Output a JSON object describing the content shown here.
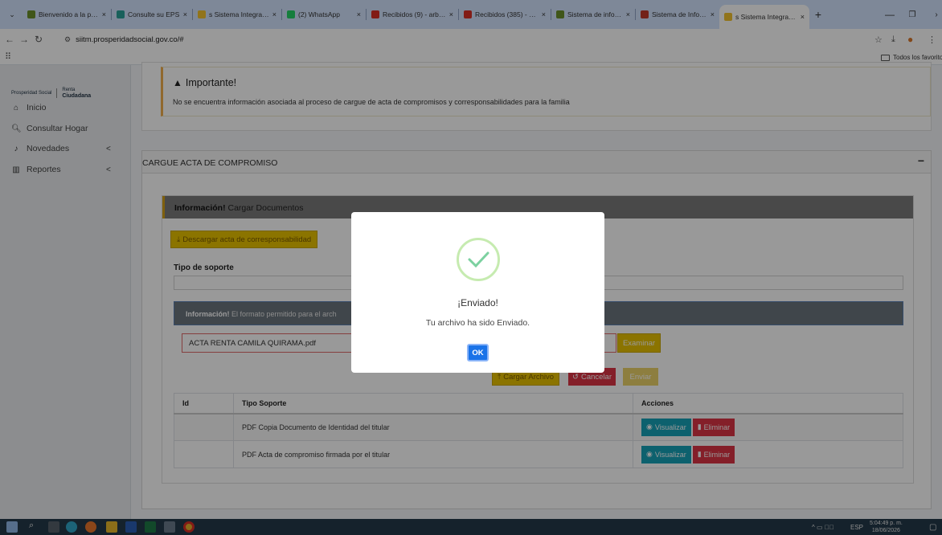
{
  "browser": {
    "tabs": [
      {
        "title": "Bienvenido a la págir",
        "color": "#6b8f2a"
      },
      {
        "title": "Consulte su EPS",
        "color": "#2aa198"
      },
      {
        "title": "s Sistema Integrado d",
        "color": "#f2c12e"
      },
      {
        "title": "(2) WhatsApp",
        "color": "#25d366"
      },
      {
        "title": "Recibidos (9) - arbela",
        "color": "#d93025"
      },
      {
        "title": "Recibidos (385) - prod",
        "color": "#d93025"
      },
      {
        "title": "Sistema de informaci",
        "color": "#6b8f2a"
      },
      {
        "title": "Sistema de Informaci",
        "color": "#c0392b"
      },
      {
        "title": "s Sistema Integrado d",
        "color": "#f2c12e",
        "active": true
      }
    ],
    "new_tab": "+",
    "url": "siitm.prosperidadsocial.gov.co/#",
    "bookmarks_all": "Todos los favoritos"
  },
  "sidebar": {
    "logo_left": "Prosperidad Social",
    "logo_right_top": "Renta",
    "logo_right_bottom": "Ciudadana",
    "items": [
      {
        "label": "Inicio",
        "icon": "home-icon"
      },
      {
        "label": "Consultar Hogar",
        "icon": "search-icon"
      },
      {
        "label": "Novedades",
        "icon": "bell-icon",
        "chevron": "<"
      },
      {
        "label": "Reportes",
        "icon": "chart-icon",
        "chevron": "<"
      }
    ]
  },
  "alert": {
    "title": "Importante!",
    "body": "No se encuentra información asociada al proceso de cargue de acta de compromisos y corresponsabilidades para la familia"
  },
  "card": {
    "title": "CARGUE ACTA DE COMPROMISO",
    "collapse": "−",
    "info_bold": "Información!",
    "info_rest": " Cargar Documentos",
    "download_label": "Descargar acta de corresponsabilidad",
    "tipo_label": "Tipo de soporte",
    "format_bold": "Información!",
    "format_rest": "  El formato permitido para el arch",
    "file_value": "ACTA RENTA CAMILA QUIRAMA.pdf",
    "browse_label": "Examinar",
    "upload_label": "Cargar Archivo",
    "cancel_label": "Cancelar",
    "send_label": "Enviar"
  },
  "table": {
    "headers": [
      "Id",
      "Tipo Soporte",
      "Acciones"
    ],
    "rows": [
      {
        "id": "",
        "tipo": "PDF Copia Documento de Identidad del titular"
      },
      {
        "id": "",
        "tipo": "PDF Acta de compromiso firmada por el titular"
      }
    ],
    "view_label": "Visualizar",
    "delete_label": "Eliminar"
  },
  "modal": {
    "title": "¡Enviado!",
    "text": "Tu archivo ha sido Enviado.",
    "ok": "OK"
  },
  "taskbar": {
    "lang": "ESP",
    "time": "5:04:49 p. m.",
    "date": "18/06/2026"
  },
  "colors": {
    "success_ring": "#c6ebb0",
    "success_check": "#7cd1a0",
    "ok_button": "#1a73e8",
    "warning_button": "#e8c200",
    "danger_button": "#dc3545",
    "info_button": "#17a2b8"
  }
}
